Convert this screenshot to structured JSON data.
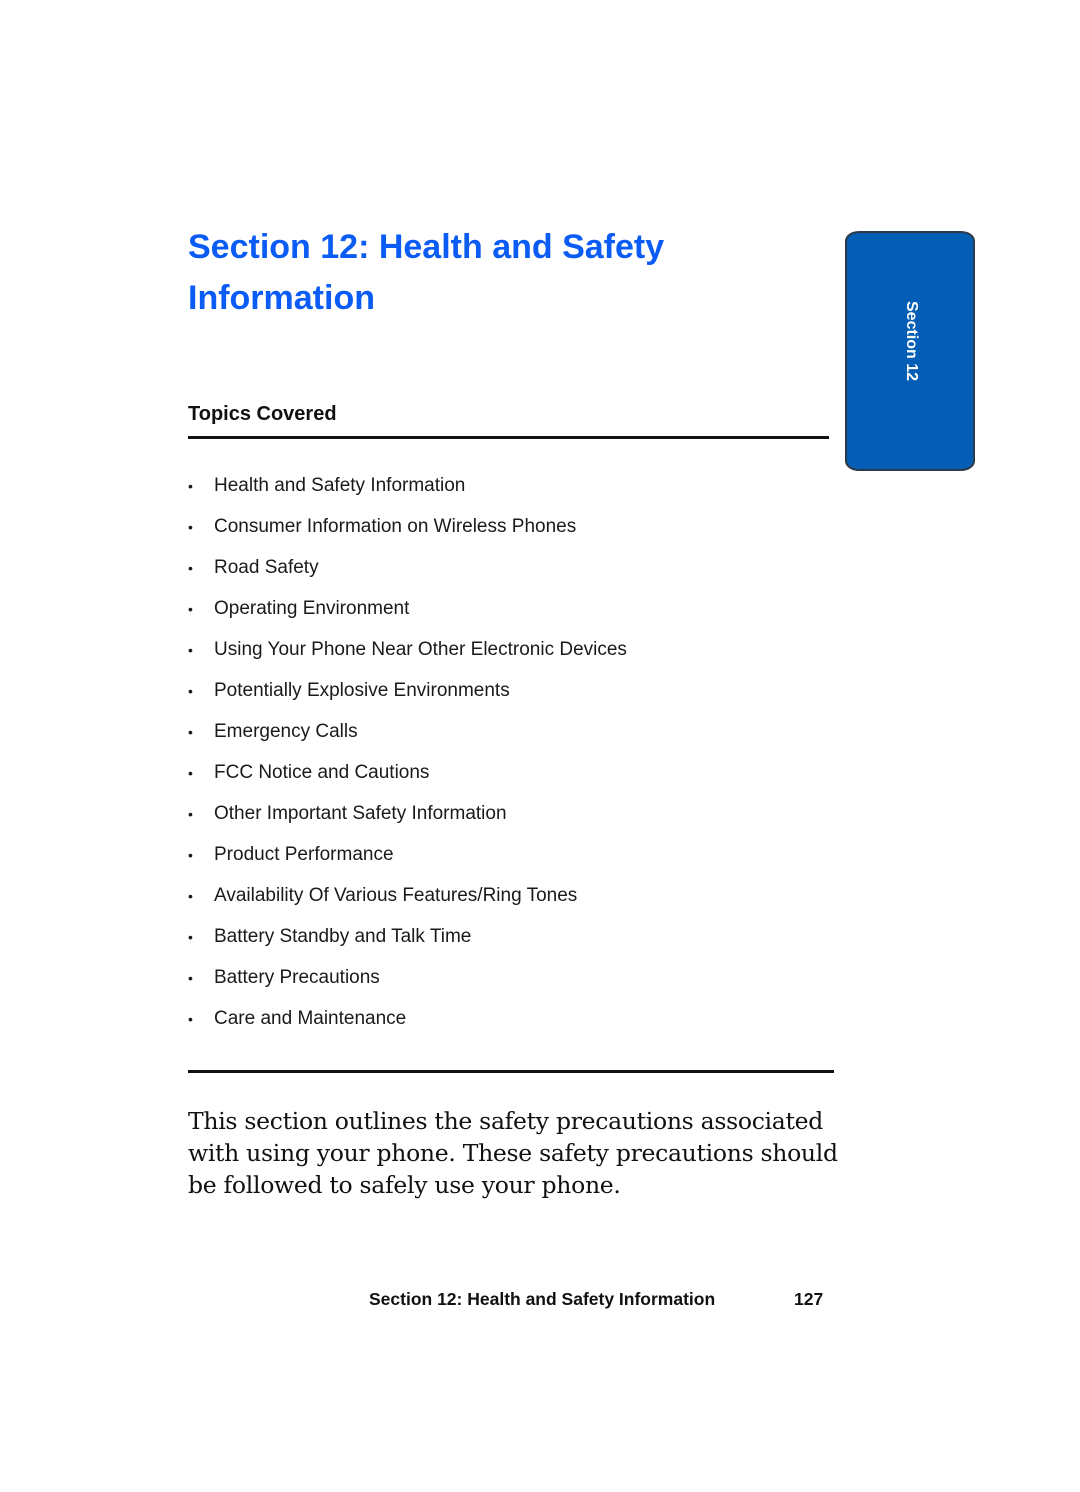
{
  "page": {
    "title": "Section 12: Health and Safety Information",
    "side_tab": {
      "label": "Section 12",
      "color": "#055eb5"
    },
    "accent_color": "#0b5cf5"
  },
  "topics": {
    "heading": "Topics Covered",
    "bullet_glyph": "•",
    "items": [
      "Health and Safety Information",
      "Consumer Information on Wireless Phones",
      "Road Safety",
      "Operating Environment",
      "Using Your Phone Near Other Electronic Devices",
      "Potentially Explosive Environments",
      "Emergency Calls",
      "FCC Notice and Cautions",
      "Other Important Safety Information",
      "Product Performance",
      "Availability Of Various Features/Ring Tones",
      "Battery Standby and Talk Time",
      "Battery Precautions",
      "Care and Maintenance"
    ]
  },
  "intro_text": "This section outlines the safety precautions associated with using your phone. These safety precautions should be followed to safely use your phone.",
  "footer": {
    "running_title": "Section 12: Health and Safety Information",
    "page_number": "127"
  }
}
